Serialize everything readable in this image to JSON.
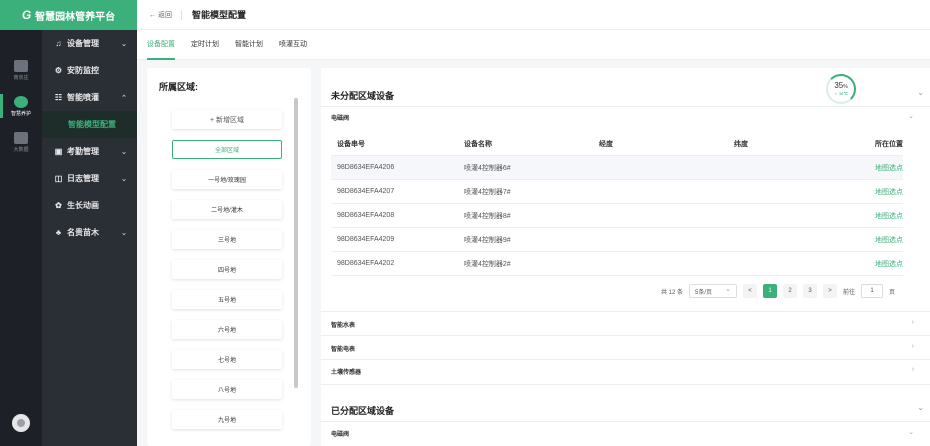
{
  "brand": {
    "logo": "G",
    "name": "智慧园林管养平台"
  },
  "rail": [
    {
      "label": "南京庄"
    },
    {
      "label": "智慧养护"
    },
    {
      "label": "大数据"
    }
  ],
  "menu": [
    {
      "icon": "bell-icon",
      "glyph": "♫",
      "label": "设备管理"
    },
    {
      "icon": "monitor-icon",
      "glyph": "⚙",
      "label": "安防监控"
    },
    {
      "icon": "irrigation-icon",
      "glyph": "☷",
      "label": "智能喷灌"
    },
    {
      "label": "智能模型配置"
    },
    {
      "icon": "calendar-icon",
      "glyph": "▣",
      "label": "考勤管理"
    },
    {
      "icon": "log-icon",
      "glyph": "◫",
      "label": "日志管理"
    },
    {
      "icon": "growth-icon",
      "glyph": "✿",
      "label": "生长动画"
    },
    {
      "icon": "tree-icon",
      "glyph": "♣",
      "label": "名贵苗木"
    }
  ],
  "header": {
    "back": "← 返回",
    "title": "智能模型配置"
  },
  "tabs": [
    "设备配置",
    "定时计划",
    "智能计划",
    "喷灌互动"
  ],
  "region": {
    "title": "所属区域:",
    "add": "+ 新增区域",
    "items": [
      "全部区域",
      "一号地/玫瑰园",
      "二号地/灌木",
      "三号地",
      "四号地",
      "五号地",
      "六号地",
      "七号地",
      "八号地",
      "九号地"
    ]
  },
  "unassigned": {
    "title": "未分配区域设备",
    "group1": "电磁阀",
    "columns": [
      "设备串号",
      "设备名称",
      "经度",
      "纬度",
      "所在位置"
    ],
    "rows": [
      {
        "serial": "98D8634EFA4206",
        "name": "喷灌4控制器6#",
        "lng": "",
        "lat": "",
        "loc": "地图选点"
      },
      {
        "serial": "98D8634EFA4207",
        "name": "喷灌4控制器7#",
        "lng": "",
        "lat": "",
        "loc": "地图选点"
      },
      {
        "serial": "98D8634EFA4208",
        "name": "喷灌4控制器8#",
        "lng": "",
        "lat": "",
        "loc": "地图选点"
      },
      {
        "serial": "98D8634EFA4209",
        "name": "喷灌4控制器9#",
        "lng": "",
        "lat": "",
        "loc": "地图选点"
      },
      {
        "serial": "98D8634EFA4202",
        "name": "喷灌4控制器2#",
        "lng": "",
        "lat": "",
        "loc": "地图选点"
      }
    ],
    "pager": {
      "total": "共 12 条",
      "size": "5条/页",
      "prev": "<",
      "pages": [
        "1",
        "2",
        "3"
      ],
      "next": ">",
      "goto": "前往",
      "current": "1",
      "unit": "页"
    },
    "groups": [
      "智能水表",
      "智能电表",
      "土壤传感器"
    ]
  },
  "assigned": {
    "title": "已分配区域设备",
    "group1": "电磁阀"
  },
  "gauge": {
    "value": "35",
    "unit": "%",
    "sub": "☆ 38℃"
  },
  "colors": {
    "accent": "#3bb07a",
    "sidebar": "#2a2f36"
  }
}
